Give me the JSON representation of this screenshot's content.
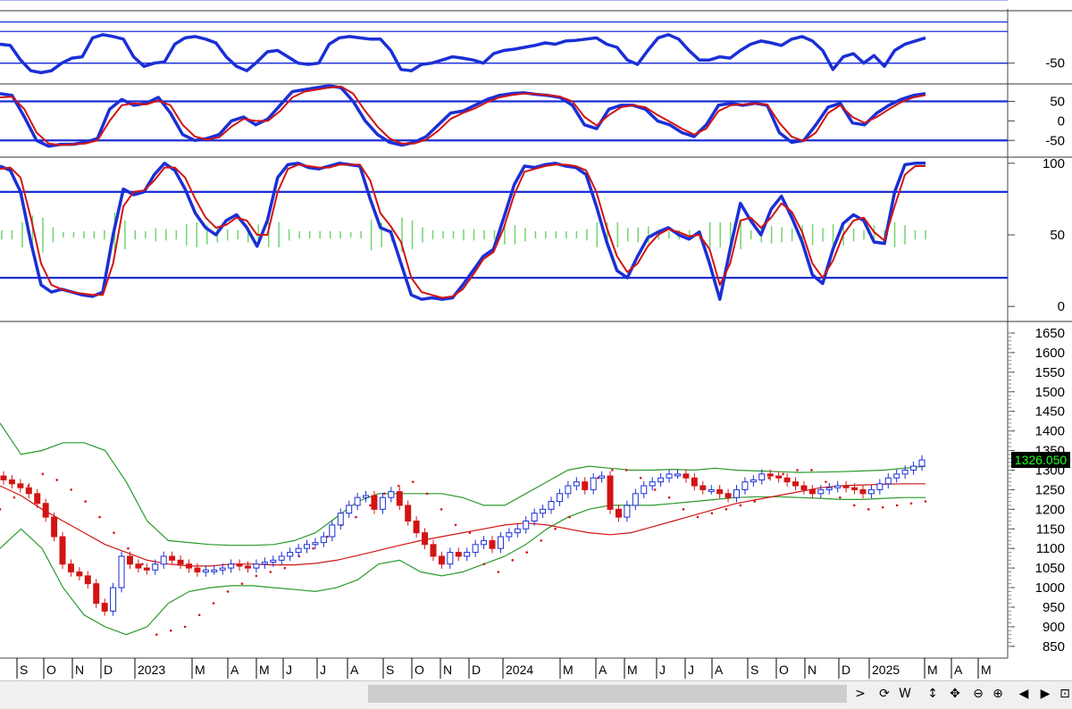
{
  "chart_data": [
    {
      "panel": "oscillator-1",
      "type": "line",
      "y_ticks": [
        "-50"
      ],
      "y_ref": [
        -50,
        0,
        50
      ],
      "series": [
        {
          "color": "#1a2fd6",
          "values": [
            -20,
            -22,
            -45,
            -62,
            -65,
            -62,
            -50,
            -42,
            -40,
            -10,
            -5,
            -8,
            -12,
            -40,
            -55,
            -50,
            -48,
            -20,
            -10,
            -8,
            -12,
            -18,
            -40,
            -55,
            -62,
            -48,
            -32,
            -30,
            -40,
            -50,
            -52,
            -50,
            -20,
            -10,
            -8,
            -10,
            -12,
            -12,
            -30,
            -60,
            -62,
            -52,
            -50,
            -45,
            -40,
            -42,
            -45,
            -50,
            -35,
            -30,
            -28,
            -25,
            -22,
            -18,
            -20,
            -15,
            -14,
            -12,
            -10,
            -20,
            -25,
            -45,
            -52,
            -30,
            -10,
            -5,
            -12,
            -30,
            -45,
            -45,
            -40,
            -42,
            -30,
            -20,
            -15,
            -18,
            -22,
            -12,
            -8,
            -15,
            -30,
            -60,
            -40,
            -35,
            -50,
            -38,
            -55,
            -30,
            -20,
            -15,
            -10
          ]
        }
      ]
    },
    {
      "panel": "oscillator-2",
      "type": "line",
      "y_ticks": [
        "50",
        "0",
        "-50"
      ],
      "y_ref": [
        50,
        -50
      ],
      "series": [
        {
          "color": "#1a2fd6",
          "values": [
            70,
            65,
            10,
            -50,
            -65,
            -60,
            -60,
            -55,
            -45,
            30,
            55,
            40,
            45,
            60,
            20,
            -35,
            -50,
            -45,
            -35,
            0,
            10,
            -10,
            5,
            40,
            75,
            80,
            85,
            90,
            85,
            50,
            0,
            -35,
            -55,
            -62,
            -55,
            -40,
            -10,
            20,
            25,
            40,
            55,
            65,
            70,
            72,
            68,
            65,
            60,
            40,
            -10,
            -20,
            30,
            40,
            40,
            30,
            0,
            -10,
            -30,
            -40,
            -10,
            40,
            45,
            40,
            45,
            40,
            -30,
            -55,
            -50,
            -10,
            35,
            45,
            -5,
            -10,
            20,
            40,
            55,
            65,
            70
          ]
        },
        {
          "color": "#d21414",
          "values": [
            60,
            62,
            30,
            -30,
            -58,
            -62,
            -60,
            -58,
            -50,
            0,
            40,
            45,
            42,
            52,
            40,
            -10,
            -40,
            -48,
            -42,
            -15,
            5,
            0,
            0,
            25,
            60,
            75,
            80,
            85,
            88,
            70,
            25,
            -15,
            -45,
            -58,
            -58,
            -48,
            -25,
            5,
            20,
            32,
            48,
            60,
            66,
            70,
            69,
            66,
            62,
            50,
            10,
            -12,
            15,
            35,
            40,
            35,
            15,
            -2,
            -20,
            -35,
            -20,
            25,
            40,
            42,
            44,
            42,
            -5,
            -40,
            -52,
            -30,
            20,
            40,
            10,
            -5,
            10,
            30,
            48,
            60,
            66
          ]
        }
      ]
    },
    {
      "panel": "stochastic",
      "type": "line",
      "y_ticks": [
        "100",
        "50",
        "0"
      ],
      "y_ref": [
        80,
        20
      ],
      "series": [
        {
          "color": "#1a2fd6",
          "values": [
            98,
            95,
            80,
            45,
            15,
            10,
            12,
            10,
            8,
            7,
            10,
            50,
            82,
            78,
            80,
            92,
            100,
            95,
            82,
            65,
            55,
            50,
            60,
            64,
            55,
            42,
            60,
            90,
            99,
            100,
            97,
            96,
            98,
            100,
            99,
            98,
            75,
            55,
            52,
            30,
            8,
            5,
            6,
            5,
            6,
            15,
            25,
            35,
            40,
            62,
            85,
            98,
            97,
            99,
            100,
            98,
            97,
            92,
            70,
            45,
            25,
            20,
            35,
            48,
            52,
            55,
            50,
            47,
            52,
            30,
            5,
            40,
            72,
            60,
            50,
            68,
            77,
            62,
            45,
            22,
            16,
            40,
            58,
            64,
            60,
            45,
            44,
            80,
            99,
            100,
            100
          ]
        },
        {
          "color": "#d21414",
          "values": [
            96,
            97,
            90,
            62,
            30,
            15,
            12,
            10,
            9,
            8,
            8,
            30,
            70,
            80,
            81,
            88,
            97,
            97,
            90,
            75,
            62,
            55,
            57,
            62,
            60,
            50,
            50,
            80,
            96,
            99,
            98,
            97,
            97,
            99,
            99,
            99,
            88,
            65,
            56,
            45,
            20,
            10,
            8,
            6,
            7,
            12,
            22,
            33,
            38,
            55,
            78,
            94,
            96,
            98,
            99,
            99,
            98,
            95,
            80,
            55,
            35,
            24,
            30,
            42,
            50,
            54,
            52,
            49,
            50,
            40,
            15,
            30,
            60,
            62,
            55,
            62,
            72,
            66,
            52,
            30,
            20,
            32,
            50,
            60,
            62,
            52,
            46,
            70,
            92,
            98,
            98
          ]
        }
      ],
      "histogram_color": "#6fd66f"
    },
    {
      "panel": "price",
      "type": "candlestick",
      "y_ticks": [
        "1650",
        "1600",
        "1550",
        "1500",
        "1450",
        "1400",
        "1350",
        "1300",
        "1250",
        "1200",
        "1150",
        "1100",
        "1050",
        "1000",
        "950",
        "900",
        "850"
      ],
      "ylim": [
        820,
        1675
      ],
      "last_price_label": "1326.050",
      "up_color": "#1a2fd6",
      "down_color": "#d21414",
      "x_labels": [
        "S",
        "O",
        "N",
        "D",
        "2023",
        "M",
        "A",
        "M",
        "J",
        "J",
        "A",
        "S",
        "O",
        "N",
        "D",
        "2024",
        "M",
        "A",
        "M",
        "J",
        "J",
        "A",
        "S",
        "O",
        "N",
        "D",
        "2025",
        "M",
        "A",
        "M"
      ],
      "closes": [
        1275,
        1265,
        1255,
        1240,
        1215,
        1180,
        1130,
        1060,
        1040,
        1030,
        1010,
        960,
        940,
        1000,
        1080,
        1060,
        1050,
        1045,
        1060,
        1080,
        1070,
        1060,
        1050,
        1040,
        1045,
        1045,
        1050,
        1060,
        1055,
        1050,
        1060,
        1065,
        1070,
        1080,
        1090,
        1100,
        1110,
        1115,
        1130,
        1160,
        1190,
        1210,
        1230,
        1235,
        1200,
        1230,
        1245,
        1210,
        1170,
        1140,
        1110,
        1080,
        1060,
        1090,
        1080,
        1090,
        1110,
        1120,
        1100,
        1130,
        1140,
        1150,
        1170,
        1190,
        1200,
        1220,
        1240,
        1260,
        1270,
        1250,
        1280,
        1285,
        1200,
        1180,
        1210,
        1240,
        1260,
        1270,
        1280,
        1290,
        1290,
        1280,
        1260,
        1250,
        1250,
        1240,
        1230,
        1250,
        1270,
        1275,
        1290,
        1285,
        1280,
        1270,
        1260,
        1250,
        1240,
        1250,
        1255,
        1260,
        1255,
        1250,
        1240,
        1250,
        1265,
        1280,
        1290,
        1300,
        1310,
        1326
      ],
      "bb_mid": [
        1260,
        1235,
        1200,
        1170,
        1140,
        1110,
        1090,
        1070,
        1060,
        1055,
        1055,
        1060,
        1060,
        1058,
        1058,
        1062,
        1070,
        1082,
        1095,
        1108,
        1120,
        1130,
        1140,
        1150,
        1160,
        1165,
        1160,
        1150,
        1140,
        1135,
        1140,
        1155,
        1170,
        1185,
        1200,
        1215,
        1225,
        1235,
        1245,
        1255,
        1260,
        1262,
        1264,
        1265,
        1265
      ],
      "bb_upper": [
        1420,
        1340,
        1350,
        1370,
        1370,
        1350,
        1270,
        1170,
        1120,
        1115,
        1110,
        1108,
        1108,
        1110,
        1120,
        1140,
        1180,
        1220,
        1240,
        1240,
        1240,
        1240,
        1230,
        1210,
        1210,
        1240,
        1270,
        1300,
        1310,
        1305,
        1300,
        1300,
        1302,
        1300,
        1305,
        1300,
        1298,
        1296,
        1294,
        1295,
        1296,
        1298,
        1300,
        1305,
        1310
      ],
      "bb_lower": [
        1100,
        1150,
        1100,
        1000,
        930,
        900,
        880,
        900,
        960,
        990,
        1000,
        1005,
        1005,
        1000,
        995,
        990,
        1000,
        1020,
        1060,
        1070,
        1040,
        1030,
        1040,
        1060,
        1080,
        1110,
        1150,
        1180,
        1200,
        1210,
        1210,
        1210,
        1215,
        1220,
        1225,
        1230,
        1232,
        1232,
        1230,
        1228,
        1225,
        1225,
        1228,
        1230,
        1230
      ],
      "psar": [
        1200,
        1230,
        1260,
        1290,
        1275,
        1250,
        1220,
        1180,
        1140,
        1100,
        1060,
        880,
        890,
        900,
        930,
        960,
        990,
        1010,
        1030,
        1040,
        1050,
        1080,
        1100,
        1130,
        1160,
        1180,
        1210,
        1240,
        1260,
        1270,
        1240,
        1200,
        1160,
        1140,
        1060,
        1040,
        1070,
        1090,
        1120,
        1150,
        1180,
        1260,
        1280,
        1300,
        1300,
        1280,
        1250,
        1230,
        1200,
        1180,
        1190,
        1200,
        1210,
        1220,
        1280,
        1290,
        1300,
        1300,
        1270,
        1230,
        1210,
        1200,
        1205,
        1210,
        1215,
        1220
      ]
    }
  ],
  "toolbar": {
    "arrow_right": ">",
    "refresh": "⟳",
    "w": "W",
    "updown": "↕",
    "move": "✥",
    "zoom_out": "⊖",
    "zoom_in": "⊕",
    "prev": "◀",
    "next": "▶",
    "window": "⊡"
  }
}
